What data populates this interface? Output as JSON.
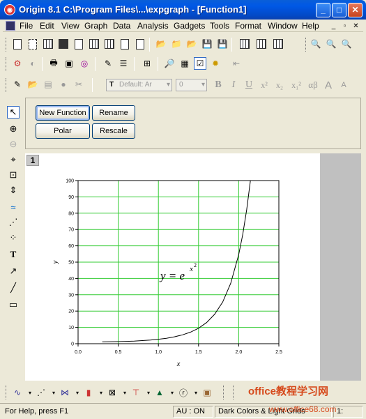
{
  "window": {
    "title": "Origin 8.1  C:\\Program Files\\...\\expgraph - [Function1]",
    "controls": [
      "_",
      "□",
      "✕"
    ]
  },
  "menu": {
    "items": [
      "File",
      "Edit",
      "View",
      "Graph",
      "Data",
      "Analysis",
      "Gadgets",
      "Tools",
      "Format",
      "Window",
      "Help"
    ],
    "mdi_controls": [
      "_",
      "▫",
      "✕"
    ]
  },
  "format_toolbar": {
    "font_name": "Default: Ar",
    "font_size": "0",
    "style_buttons": [
      "B",
      "I",
      "U",
      "x²",
      "x₂",
      "x₁²",
      "αβ",
      "A",
      "A"
    ]
  },
  "buttons": {
    "new_function": "New Function",
    "rename": "Rename",
    "polar": "Polar",
    "rescale": "Rescale"
  },
  "graph": {
    "layer_number": "1",
    "formula_base": "y = e",
    "formula_exp": "x",
    "formula_exp2": "2"
  },
  "chart_data": {
    "type": "line",
    "title": "",
    "xlabel": "x",
    "ylabel": "y",
    "xlim": [
      0.0,
      2.5
    ],
    "ylim": [
      0,
      100
    ],
    "x_ticks": [
      "0.0",
      "0.5",
      "1.0",
      "1.5",
      "2.0",
      "2.5"
    ],
    "y_ticks": [
      "0",
      "10",
      "20",
      "30",
      "40",
      "50",
      "60",
      "70",
      "80",
      "90",
      "100"
    ],
    "grid": true,
    "grid_color": "#33cc33",
    "line_color": "#000000",
    "series": [
      {
        "x": [
          0.3,
          0.5,
          0.7,
          0.9,
          1.0,
          1.1,
          1.2,
          1.3,
          1.4,
          1.5,
          1.6,
          1.7,
          1.8,
          1.9,
          2.0,
          2.05,
          2.1,
          2.146
        ],
        "y": [
          1.09,
          1.28,
          1.63,
          2.25,
          2.72,
          3.35,
          4.22,
          5.42,
          7.1,
          9.49,
          12.94,
          17.99,
          25.53,
          36.96,
          54.6,
          66.97,
          82.27,
          100.0
        ]
      }
    ]
  },
  "statusbar": {
    "help": "For Help, press F1",
    "au": "AU : ON",
    "theme": "Dark Colors & Light Grids",
    "page": "1:"
  },
  "watermark": {
    "text": "office教程学习网",
    "url": "www.office68.com"
  }
}
